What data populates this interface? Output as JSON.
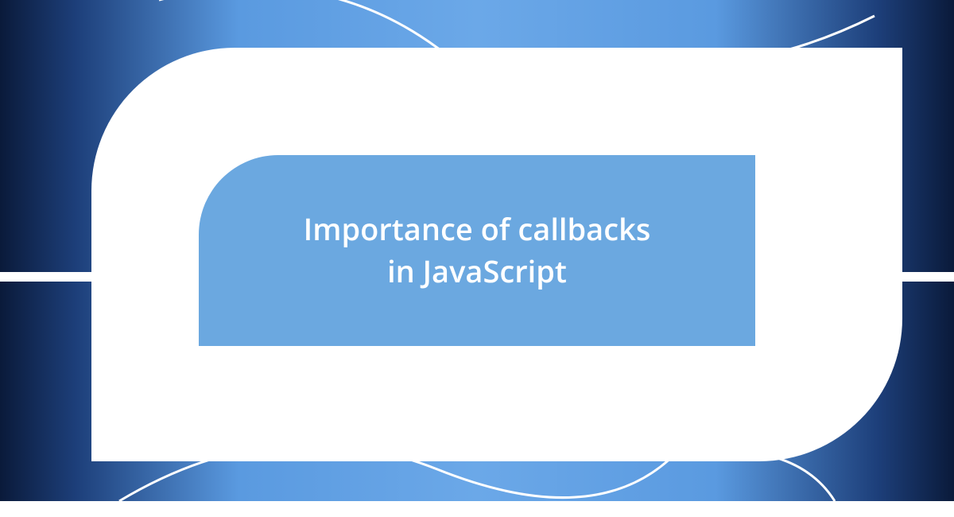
{
  "title": {
    "line1": "Importance of callbacks",
    "line2": "in JavaScript"
  },
  "colors": {
    "background_dark": "#0a1a3a",
    "background_mid": "#5a9ae0",
    "inner_panel": "#6ba8e0",
    "text": "#ffffff",
    "shape": "#ffffff"
  }
}
